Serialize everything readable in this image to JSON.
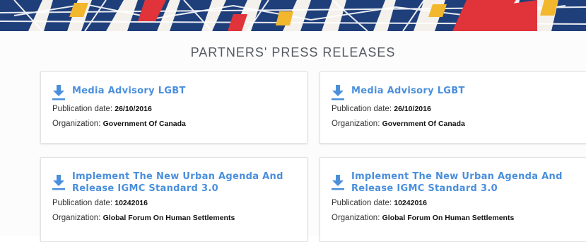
{
  "page": {
    "section_title": "PARTNERS' PRESS RELEASES"
  },
  "colors": {
    "accent": "#4a8fdc",
    "banner_navy": "#1f3f7a",
    "banner_red": "#e0333a",
    "banner_yellow": "#f3b72d"
  },
  "press_releases": [
    {
      "title": "Media Advisory LGBT",
      "date_label": "Publication date:",
      "date": "26/10/2016",
      "org_label": "Organization:",
      "organization": "Government Of Canada",
      "icon": "download-icon"
    },
    {
      "title": "Media Advisory LGBT",
      "date_label": "Publication date:",
      "date": "26/10/2016",
      "org_label": "Organization:",
      "organization": "Government Of Canada",
      "icon": "download-icon"
    },
    {
      "title": "Implement The New Urban Agenda And Release IGMC Standard 3.0",
      "date_label": "Publication date:",
      "date": "10242016",
      "org_label": "Organization:",
      "organization": "Global Forum On Human Settlements",
      "icon": "download-icon"
    },
    {
      "title": "Implement The New Urban Agenda And Release IGMC Standard 3.0",
      "date_label": "Publication date:",
      "date": "10242016",
      "org_label": "Organization:",
      "organization": "Global Forum On Human Settlements",
      "icon": "download-icon"
    }
  ]
}
